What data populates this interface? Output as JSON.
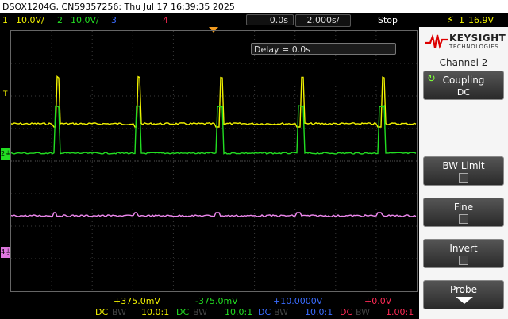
{
  "title": "DSOX1204G, CN59357256: Thu Jul 17 16:39:35 2025",
  "status": {
    "ch1": {
      "num": "1",
      "scale": "10.0V/",
      "color": "#f2f200"
    },
    "ch2": {
      "num": "2",
      "scale": "10.0V/",
      "color": "#22dd22"
    },
    "ch3": {
      "num": "3",
      "color": "#3a6cff"
    },
    "ch4": {
      "num": "4",
      "color": "#ff2a55"
    },
    "time_ref": "0.0s",
    "timebase": "2.000s/",
    "run_state": "Stop",
    "trigger_icon": "rising-edge-icon",
    "trigger_source": "1",
    "trigger_level": "16.9V"
  },
  "delay_label": "Delay = 0.0s",
  "ground_markers": [
    {
      "label": "2",
      "color": "#22dd22"
    },
    {
      "label": "4",
      "color": "#dd77dd"
    }
  ],
  "trigger_level_marker": {
    "label": "T",
    "color": "#f2f200"
  },
  "channel_info": [
    {
      "offset": "+375.0mV",
      "coupling": "DC",
      "bw": "BW",
      "probe": "10.0:1",
      "color": "#f2f200"
    },
    {
      "offset": "-375.0mV",
      "coupling": "DC",
      "bw": "BW",
      "probe": "10.0:1",
      "color": "#22dd22"
    },
    {
      "offset": "+10.0000V",
      "coupling": "DC",
      "bw": "BW",
      "probe": "10.0:1",
      "color": "#3a6cff"
    },
    {
      "offset": "+0.0V",
      "coupling": "DC",
      "bw": "BW",
      "probe": "1.00:1",
      "color": "#ff2a55"
    }
  ],
  "sidebar": {
    "brand": "KEYSIGHT",
    "brand_sub": "TECHNOLOGIES",
    "title": "Channel 2",
    "softkeys": {
      "coupling": {
        "label": "Coupling",
        "value": "DC"
      },
      "bw_limit": {
        "label": "BW Limit"
      },
      "fine": {
        "label": "Fine"
      },
      "invert": {
        "label": "Invert"
      },
      "probe": {
        "label": "Probe"
      }
    }
  },
  "colors": {
    "yellow": "#f2f200",
    "green": "#22dd22",
    "pink": "#ee88ee",
    "grid": "#3a3a3a",
    "trigger": "#f09a20"
  }
}
